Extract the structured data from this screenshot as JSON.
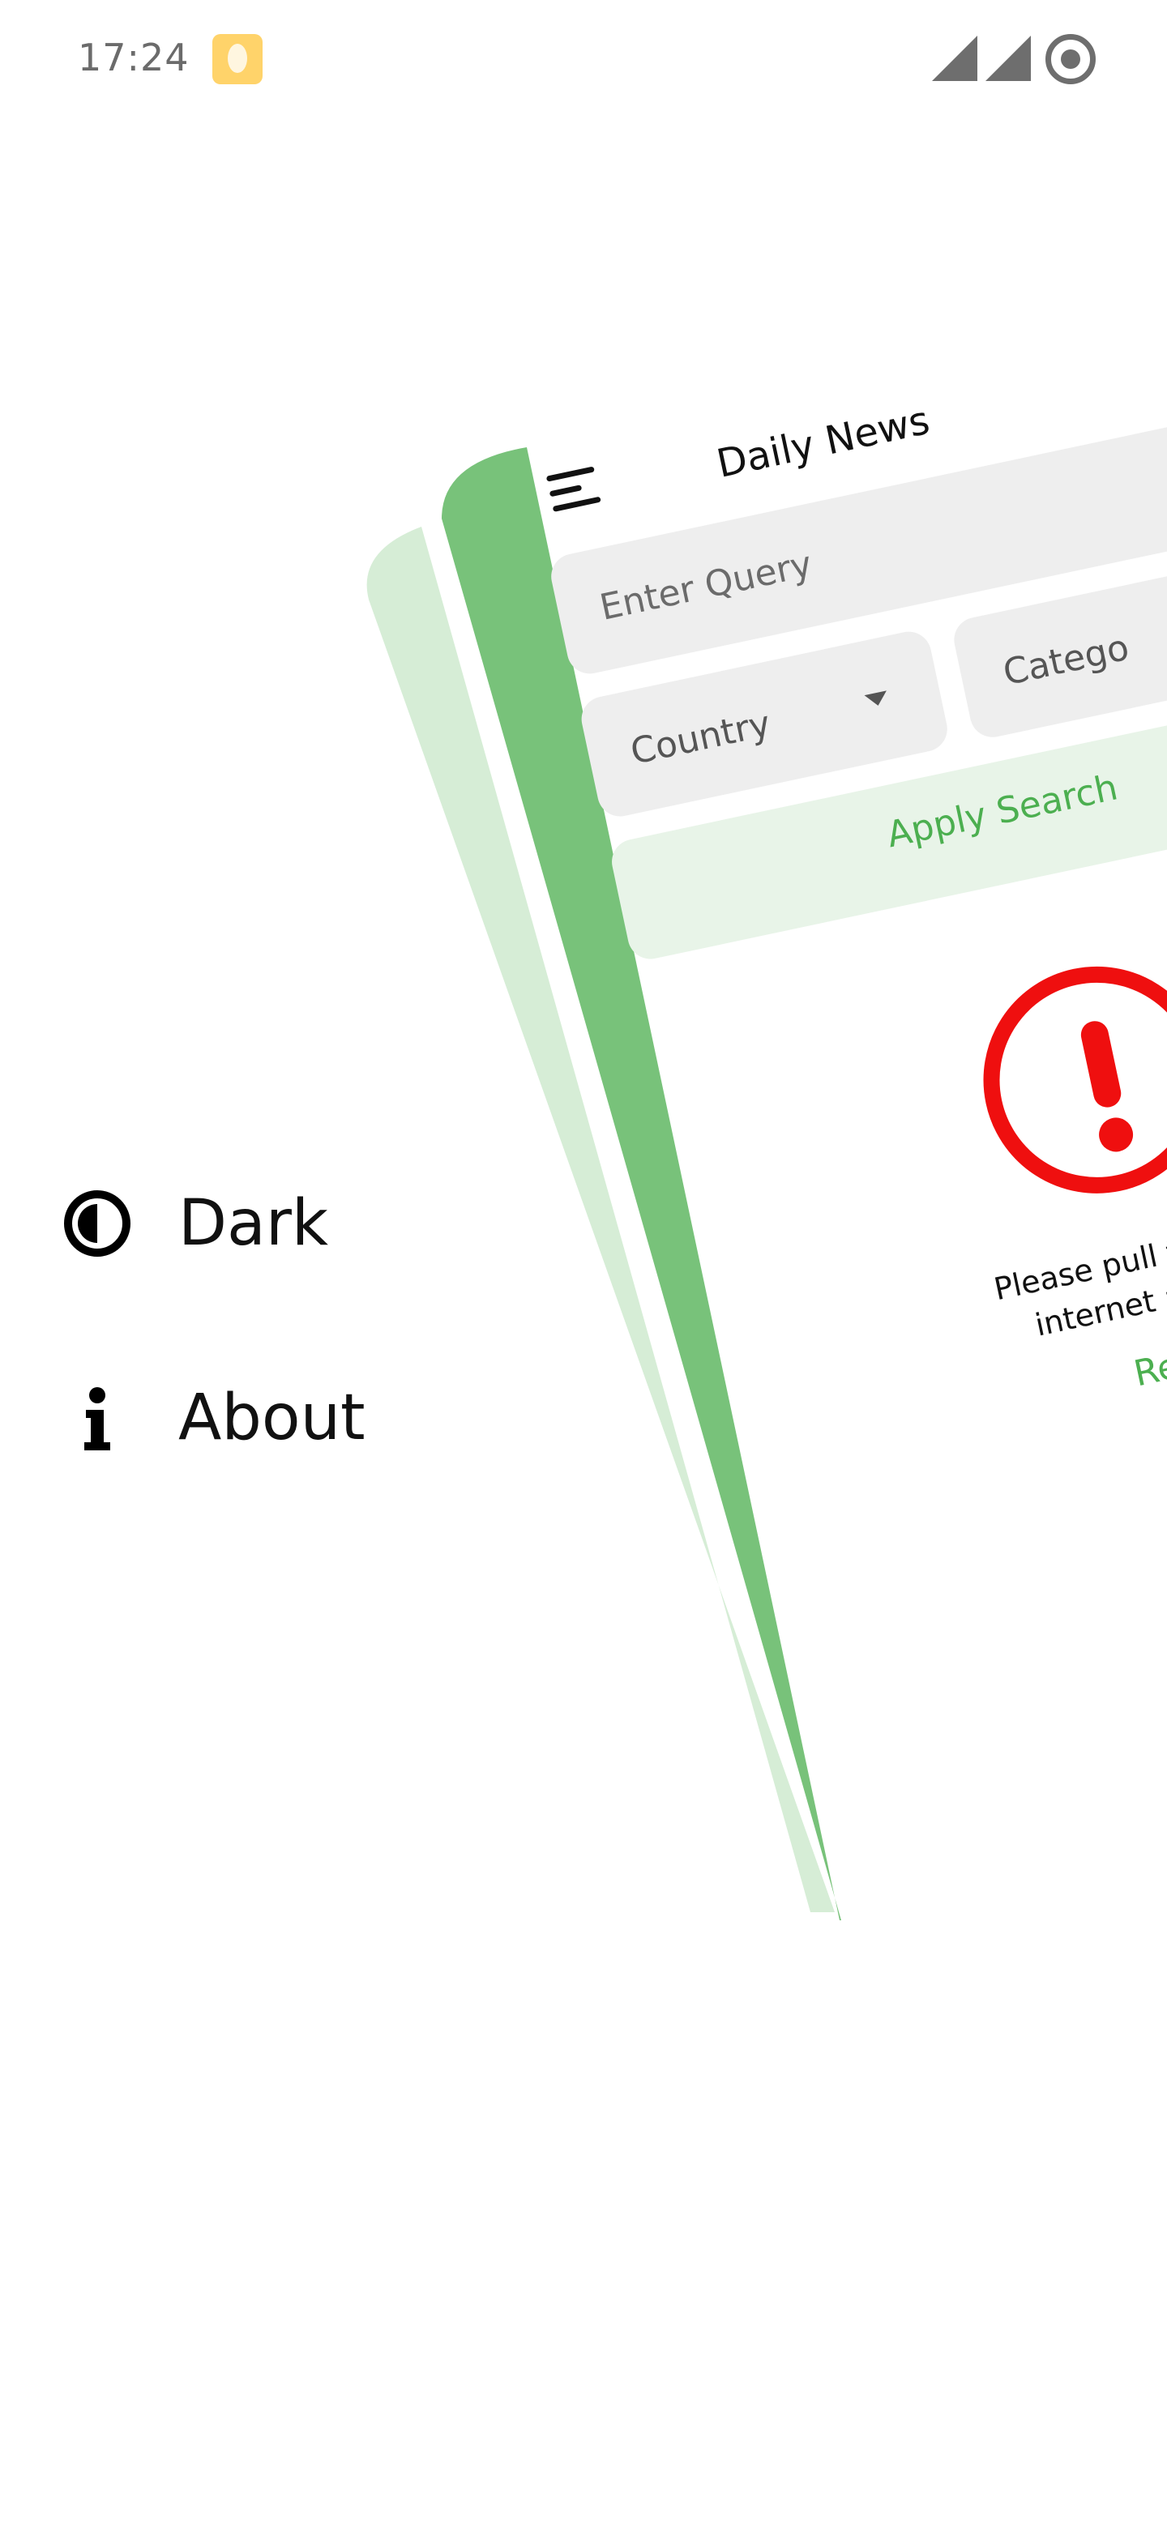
{
  "status_bar": {
    "time": "17:24",
    "notification_icon": "notification-icon",
    "signal_icon": "signal-icon",
    "record_icon": "record-icon"
  },
  "drawer": {
    "items": [
      {
        "label": "Dark",
        "icon": "contrast-icon"
      },
      {
        "label": "About",
        "icon": "info-icon"
      }
    ]
  },
  "app": {
    "title": "Daily News",
    "query_placeholder": "Enter Query",
    "country_label": "Country",
    "category_label": "Catego",
    "apply_label": "Apply Search",
    "error_message": "Please pull to refresh, Ca\ninternet and no local",
    "refresh_label": "Refre"
  },
  "colors": {
    "accent_green": "#4caf50",
    "drawer_green": "#78c27a",
    "shadow_green": "#d6edd6",
    "error_red": "#ef0f0f",
    "field_gray": "#eeeeee"
  }
}
